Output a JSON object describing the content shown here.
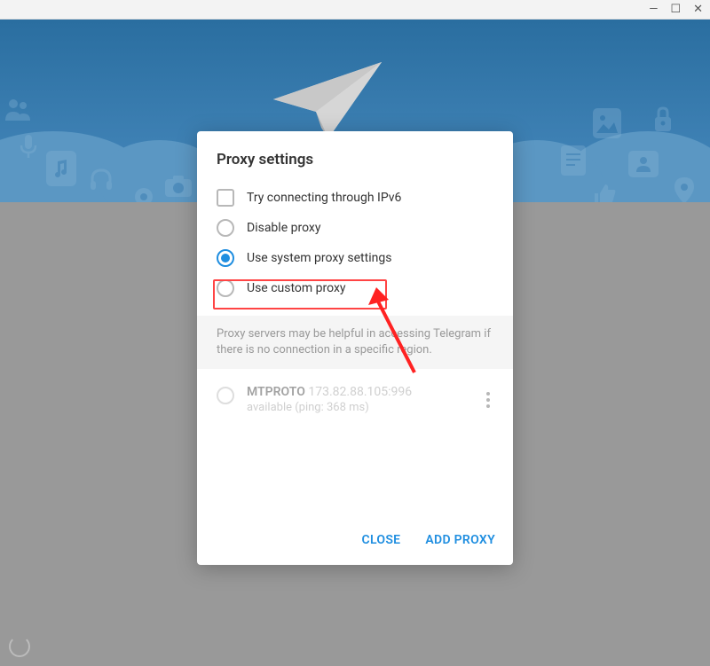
{
  "titlebar": {
    "minimize": "—",
    "maximize": "☐",
    "close": "✕"
  },
  "dialog": {
    "title": "Proxy settings",
    "ipv6_label": "Try connecting through IPv6",
    "options": [
      {
        "label": "Disable proxy",
        "selected": false
      },
      {
        "label": "Use system proxy settings",
        "selected": true
      },
      {
        "label": "Use custom proxy",
        "selected": false
      }
    ],
    "info_text": "Proxy servers may be helpful in accessing Telegram if there is no connection in a specific region.",
    "proxy": {
      "name": "MTPROTO",
      "addr": "173.82.88.105:996",
      "status": "available (ping: 368 ms)"
    },
    "footer": {
      "close": "CLOSE",
      "add": "ADD PROXY"
    }
  }
}
